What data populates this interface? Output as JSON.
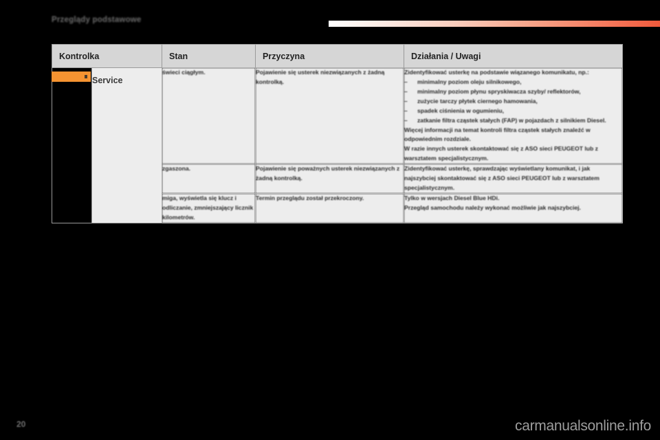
{
  "page": {
    "chapter_title": "Przeglądy podstawowe",
    "page_number": "20",
    "watermark": "carmanualsonline.info",
    "accent_gradient_start": "#ffffff",
    "accent_gradient_end": "#f05a3c",
    "indicator_color": "#f59331",
    "header_row_color": "#d6d6d6",
    "cell_color": "#ededed"
  },
  "table": {
    "headers": [
      {
        "label": "Kontrolka"
      },
      {
        "label": "Stan"
      },
      {
        "label": "Przyczyna"
      },
      {
        "label": "Działania / Uwagi"
      }
    ],
    "rows": [
      {
        "indicator_name": "Service",
        "state": "świeci ciągłym.",
        "cause": "Pojawienie się usterek niezwiązanych z żadną kontrolką.",
        "action_intro": "Zidentyfikować usterkę na podstawie wiązanego komunikatu, np.:",
        "action_bullets": [
          "minimalny poziom oleju silnikowego,",
          "minimalny poziom płynu spryskiwacza szyby/ reflektorów,",
          "zużycie tarczy płytek ciernego hamowania,",
          "spadek ciśnienia w ogumieniu,",
          "zatkanie filtra cząstek stałych (FAP) w pojazdach z silnikiem Diesel."
        ],
        "action_paragraphs": [
          "Więcej informacji na temat kontroli filtra cząstek stałych znaleźć w odpowiednim rozdziale.",
          "W razie innych usterek skontaktować się z ASO sieci PEUGEOT lub z warsztatem specjalistycznym."
        ]
      },
      {
        "state": "zgaszona.",
        "cause": "Pojawienie się poważnych usterek niezwiązanych z żadną kontrolką.",
        "action_intro": "",
        "action_bullets": [],
        "action_paragraphs": [
          "Zidentyfikować usterkę, sprawdzając wyświetlany komunikat, i jak najszybciej skontaktować się z ASO sieci PEUGEOT lub z warsztatem specjalistycznym."
        ]
      },
      {
        "state": "miga, wyświetla się klucz i odliczanie, zmniejszający licznik kilometrów.",
        "cause": "Termin przeglądu został przekroczony.",
        "action_intro": "",
        "action_bullets": [],
        "action_paragraphs": [
          "Tylko w wersjach Diesel Blue HDi.",
          "Przegląd samochodu należy wykonać możliwie jak najszybciej."
        ]
      }
    ]
  },
  "symbols": {
    "dash": "–"
  }
}
